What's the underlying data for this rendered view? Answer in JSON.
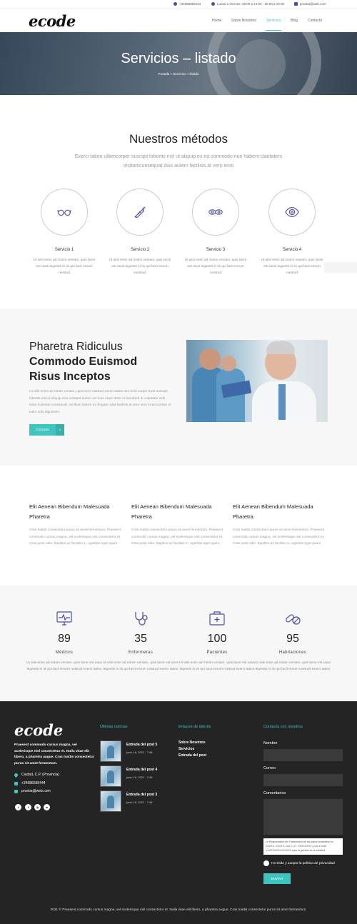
{
  "topbar": {
    "phone": "+34686555444",
    "hours": "Lunes a Viernes: 08:00 a 14:00 - 16:00 a 19:00",
    "email": "prueba@web.com"
  },
  "header": {
    "logo": "ecode",
    "nav": [
      "Home",
      "Sobre Nosotros",
      "Servicios",
      "Blog",
      "Contacto"
    ],
    "active_nav": "Servicios"
  },
  "hero": {
    "title": "Servicios – listado",
    "breadcrumb": "Portada » Servicios » listado"
  },
  "methods": {
    "title": "Nuestros métodos",
    "description": "Exerci tation ullamcorper suscipit lobortis nisl ut aliquip ex ea commodo non habent claritatem insitamconsequat duis autem facilisis at vero eros",
    "services": [
      {
        "name": "Servicio 1",
        "icon": "glasses-icon",
        "text": "Ut wisi enim ad minim veniam, quis lacre est usus legentis in iis qui facit eorum nostrud"
      },
      {
        "name": "Servicio 2",
        "icon": "syringe-icon",
        "text": "Ut wisi enim ad minim veniam, quis lacre est usus legentis in iis qui facit eorum nostrud"
      },
      {
        "name": "Servicio 3",
        "icon": "eyes-icon",
        "text": "Ut wisi enim ad minim veniam, quis lacre est usus legentis in iis qui facit eorum nostrud"
      },
      {
        "name": "Servicio 4",
        "icon": "eye-icon",
        "text": "Ut wisi enim ad minim veniam, quis lacre est usus legentis in iis qui facit eorum nostrud"
      }
    ]
  },
  "feature": {
    "title_light": "Pharetra Ridiculus",
    "title_bold_1": "Commodo Euismod",
    "title_bold_2": "Risus Inceptos",
    "text": "Ut wisi enim ad minim veniam, quis lacre nostrud exerci tation ulm hedi corper turet suscipit lobortis nisl ut aliquip erat volutpat autem vel eum iriure dolor in hendrerit in vulputate velit esse molestie consequat, vel illum dolore eu feugiat nulla facilisis at vero eros et accumsan et iusto odio dignissim.",
    "button": "Contacto",
    "button_arrow": "›"
  },
  "columns": [
    {
      "title": "Elit Aenean Bibendum Malesuada Pharetra",
      "text": "Cras mattis consectetur purus sit amet fermentum. Praesent commodo cursus magna, vel scelerisque nisl consectetur et. Cras justo odio, dapibus ac facilisis in, egestas eget quam."
    },
    {
      "title": "Elit Aenean Bibendum Malesuada Pharetra",
      "text": "Cras mattis consectetur purus sit amet fermentum. Praesent commodo cursus magna, vel scelerisque nisl consectetur et. Cras justo odio, dapibus ac facilisis in, egestas eget quam."
    },
    {
      "title": "Elit Aenean Bibendum Malesuada Pharetra",
      "text": "Cras mattis consectetur purus sit amet fermentum. Praesent commodo cursus magna, vel scelerisque nisl consectetur et. Cras justo odio, dapibus ac facilisis in, egestas eget quam."
    }
  ],
  "stats": [
    {
      "number": "89",
      "label": "Médicos",
      "icon": "monitor-icon",
      "text": "Ut wisi enim ad minim veniam, quis lacre est usus legentis in iis qui facit eorum nostrud exerci tation"
    },
    {
      "number": "35",
      "label": "Enfermeras",
      "icon": "stethoscope-icon",
      "text": "Ut wisi enim ad minim veniam, quis lacre est usus legentis in iis qui facit eorum nostrud exerci tation"
    },
    {
      "number": "100",
      "label": "Pacientes",
      "icon": "medkit-icon",
      "text": "Ut wisi enim ad minim veniam, quis lacre est usus legentis in iis qui facit eorum nostrud exerci tation"
    },
    {
      "number": "95",
      "label": "Habitaciones",
      "icon": "pills-icon",
      "text": "Ut wisi enim ad minim veniam, quis lacre est usus legentis in iis qui facit eorum nostrud exerci tation"
    }
  ],
  "footer": {
    "logo": "ecode",
    "about": "Praesent commodo cursus magna, vel scelerisque nisl consectetur et. Nulla vitae elit libero, a pharetra augue. Cras mattis consectetur purus sit amet fermentum.",
    "address": "Ciudad, C.P. (Provincia)",
    "phone": "+34686555444",
    "email": "prueba@web.com",
    "social": [
      "twitter-icon",
      "facebook-icon",
      "instagram-icon",
      "linkedin-icon"
    ],
    "news_title": "Últimas noticias",
    "posts": [
      {
        "title": "Entrada del post 5",
        "date": "junio 16, 2021 - 7:46"
      },
      {
        "title": "Entrada del post 4",
        "date": "junio 16, 2021 - 7:46"
      },
      {
        "title": "Entrada del post 3",
        "date": "junio 16, 2021 - 7:46"
      }
    ],
    "links_title": "Enlaces de interés",
    "links": [
      "Sobre Nosotros",
      "Servicios",
      "Entrada del post"
    ],
    "contact_title": "Contacta con nosotros",
    "form": {
      "name_label": "Nombre",
      "email_label": "Correo",
      "comments_label": "Comentarios",
      "legal": "Le Responsable del Tratamiento de los datos recabados es XXXXX, XXXXX, con C.I.F.: XXXXXXXX y con e-mail XXXXXXXXXXXXXXX para la gestión de la solicitud",
      "consent": "He leído y acepto la política de privacidad",
      "submit": "ENVIAR"
    },
    "copyright": "2021 © Praesent commodo cursus magna, vel scelerisque nisl consectetur et. Nulla vitae elit libero, a pharetra augue. Cras mattis consectetur purus sit amet fermentum."
  },
  "colors": {
    "accent": "#3fc5bf",
    "footer_bg": "#242424",
    "icon_blue": "#4b4bb0"
  }
}
